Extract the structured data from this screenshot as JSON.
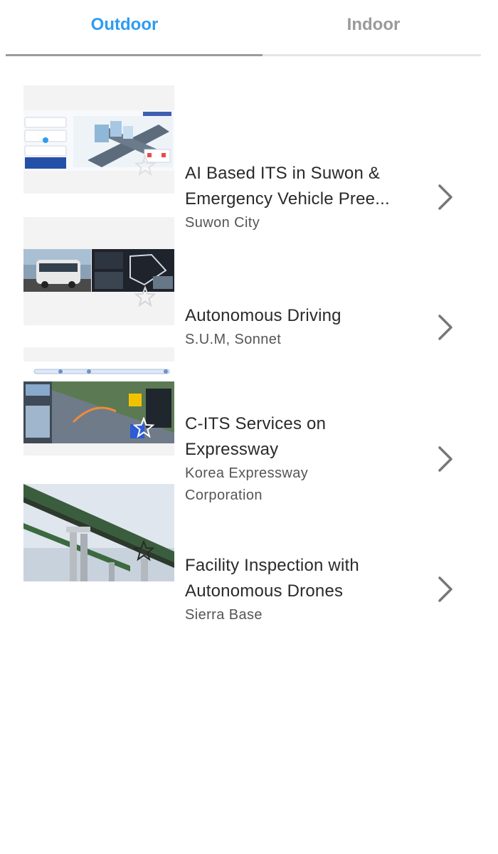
{
  "tabs": [
    {
      "label": "Outdoor",
      "active": true
    },
    {
      "label": "Indoor",
      "active": false
    }
  ],
  "colors": {
    "accent": "#2e9cf2",
    "inactive_tab": "#9a9a9a",
    "title_text": "#2a2a2a",
    "subtitle_text": "#555555",
    "chevron": "#777777"
  },
  "items": [
    {
      "title_line1": "AI Based ITS in Suwon &",
      "title_line2": "Emergency Vehicle Pree...",
      "subtitle_line1": "Suwon City",
      "subtitle_line2": "",
      "thumbnail_icon": "its-dashboard-thumbnail",
      "favorite_icon": "star-outline-icon"
    },
    {
      "title_line1": "Autonomous Driving",
      "title_line2": "",
      "subtitle_line1": "S.U.M, Sonnet",
      "subtitle_line2": "",
      "thumbnail_icon": "autonomous-bus-thumbnail",
      "favorite_icon": "star-outline-icon"
    },
    {
      "title_line1": "C-ITS Services on",
      "title_line2": "Expressway",
      "subtitle_line1": "Korea Expressway",
      "subtitle_line2": "Corporation",
      "thumbnail_icon": "expressway-map-thumbnail",
      "favorite_icon": "star-outline-icon"
    },
    {
      "title_line1": "Facility Inspection with",
      "title_line2": "Autonomous Drones",
      "subtitle_line1": "Sierra Base",
      "subtitle_line2": "",
      "thumbnail_icon": "bridge-photo-thumbnail",
      "favorite_icon": "star-outline-icon"
    }
  ]
}
